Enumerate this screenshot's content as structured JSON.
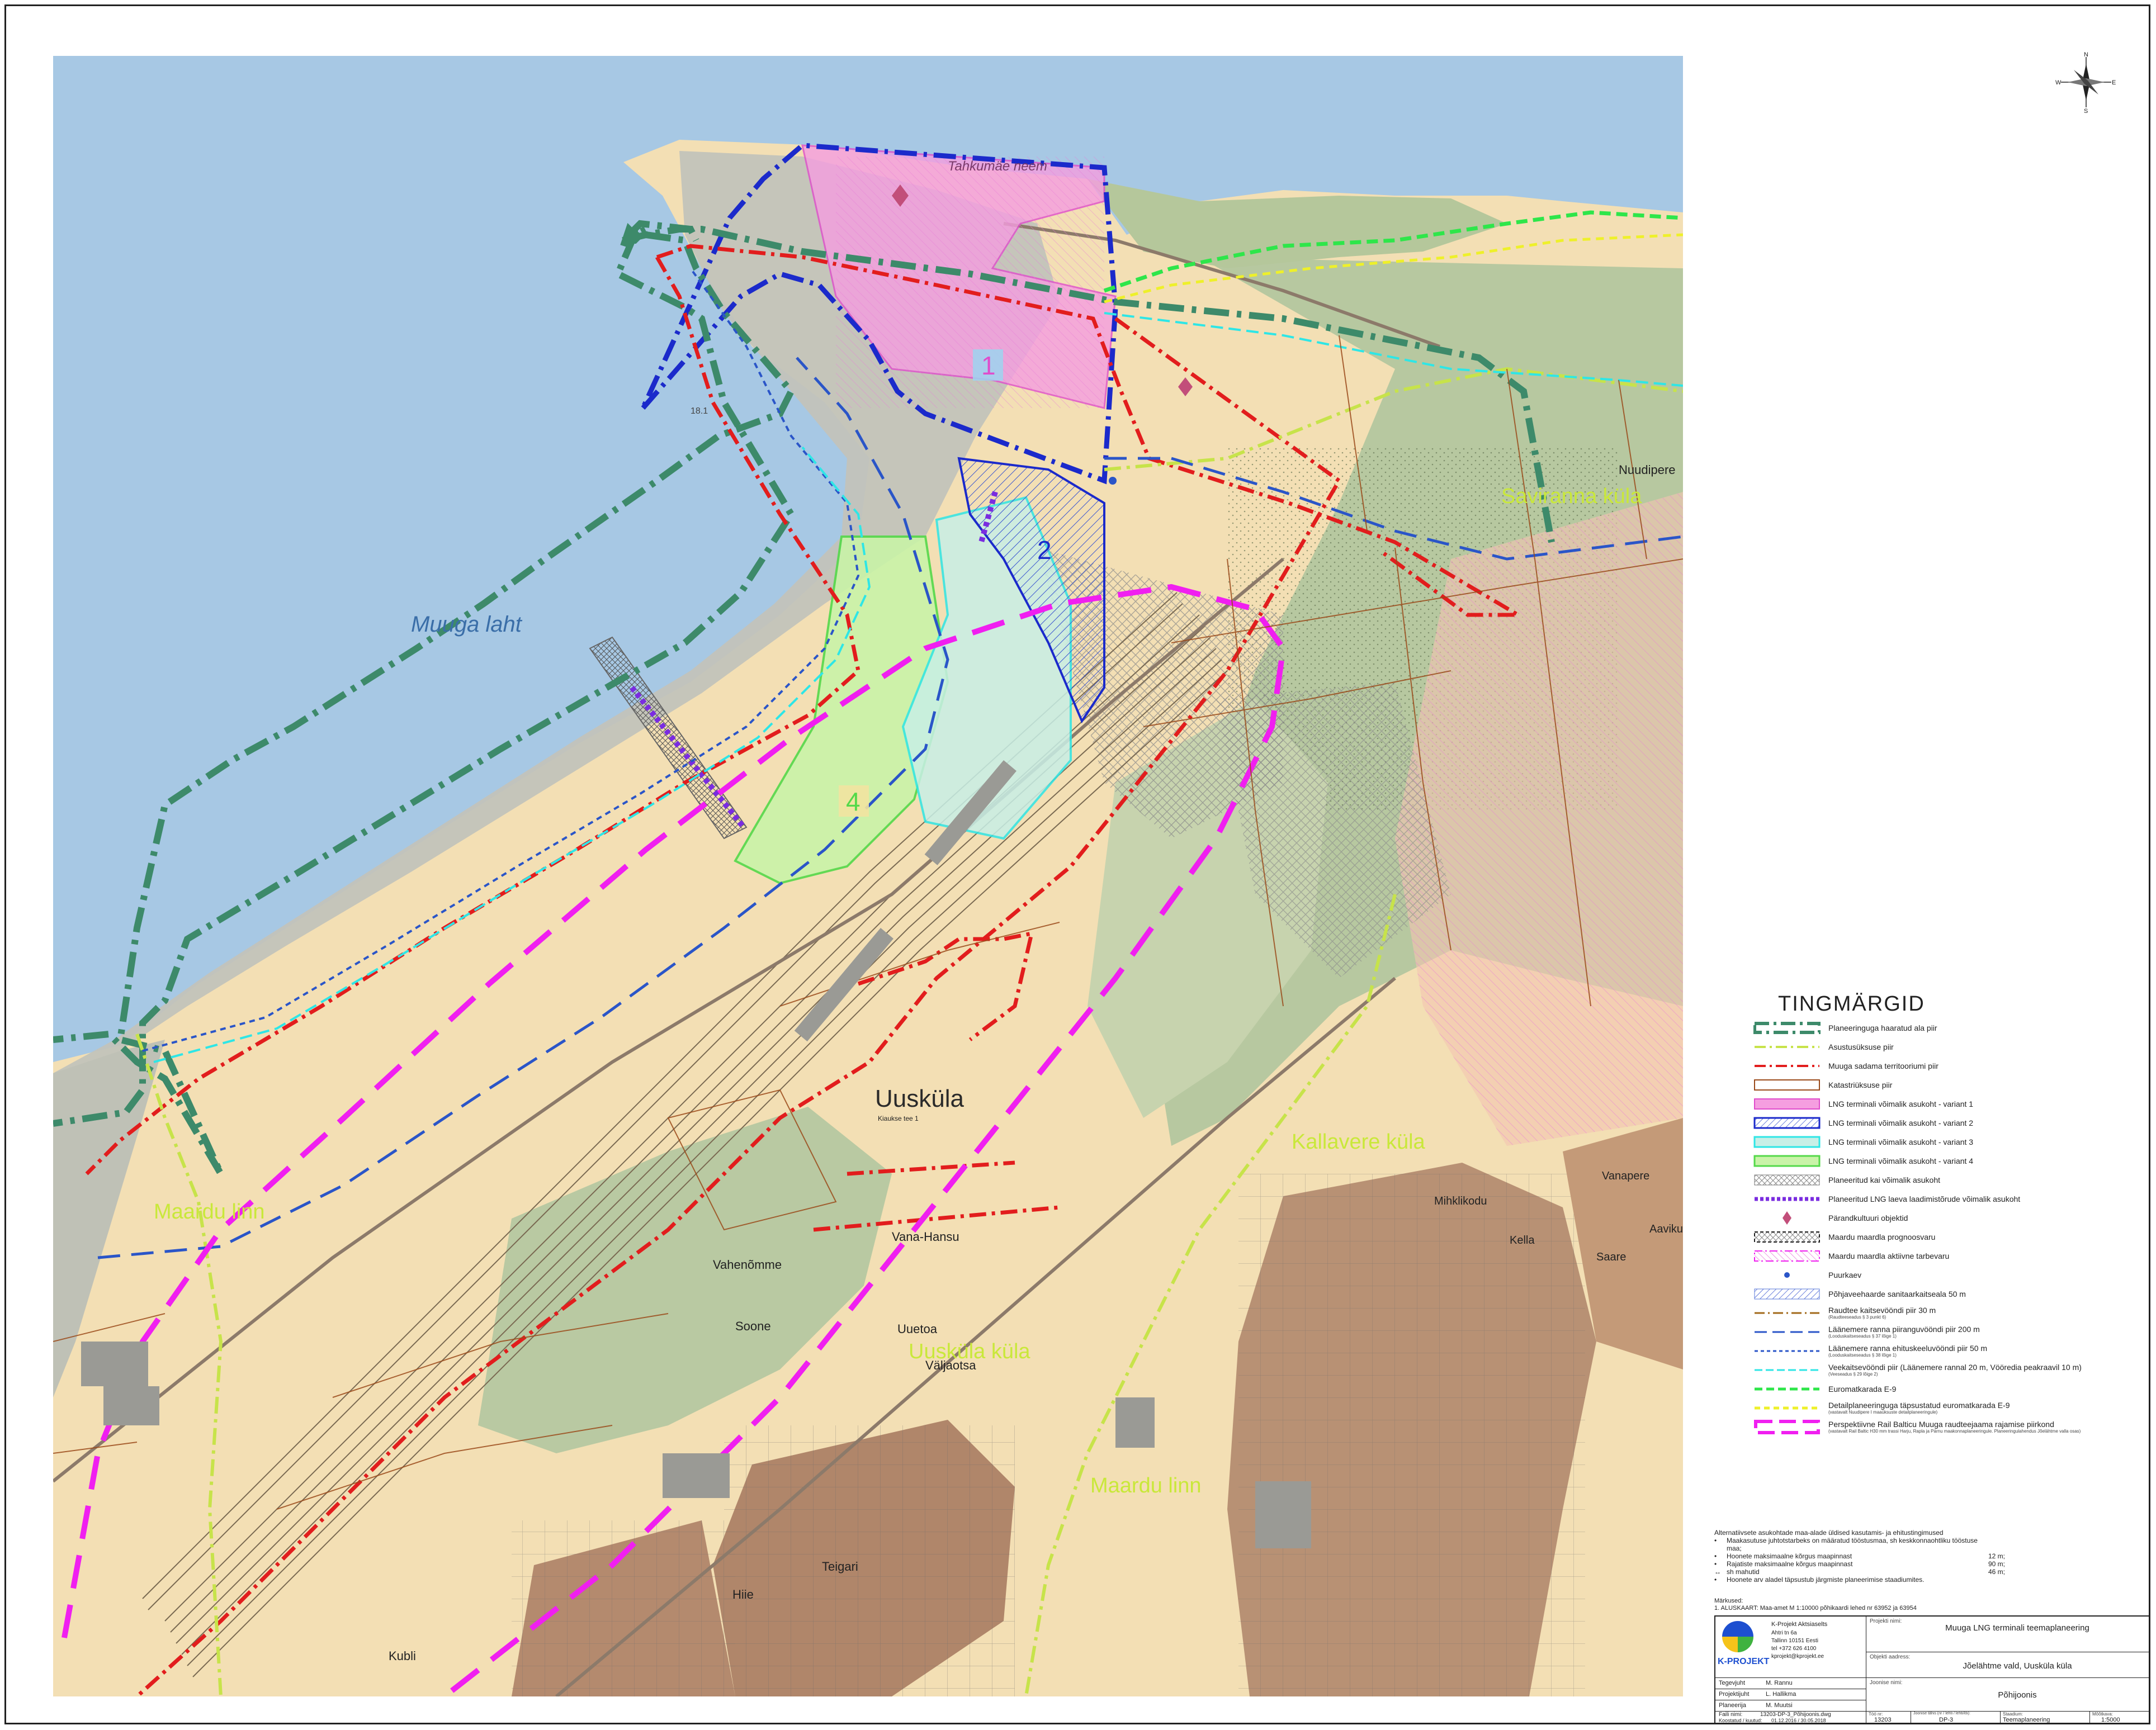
{
  "map": {
    "labels": {
      "muuga_laht": "Muuga laht",
      "tahkumae_neem": "Tahkumäe neem",
      "uuskula": "Uusküla",
      "maardu_linn_west": "Maardu linn",
      "maardu_linn_south": "Maardu linn",
      "saviranna_kula": "Saviranna küla",
      "kallavere_kula": "Kallavere küla",
      "uuskula_kula": "Uusküla küla",
      "nuudipere": "Nuudipere",
      "vahenomme": "Vahenõmme",
      "vana_hansu": "Vana-Hansu",
      "soone": "Soone",
      "uuetoa": "Uuetoa",
      "valjaotsa": "Väljaotsa",
      "teigari": "Teigari",
      "hiie": "Hiie",
      "kubli": "Kubli",
      "mihkli_kodu": "Mihklikodu",
      "kella": "Kella",
      "vanapere": "Vanapere",
      "aavik": "Aaviku",
      "saare": "Saare",
      "variant_1": "1",
      "variant_2": "2",
      "variant_4": "4",
      "parcel_kiaukse": "Kiaukse tee 1",
      "depth_181": "18.1"
    },
    "colors": {
      "sea": "#a7c8e4",
      "land": "#f3dfb4",
      "port": "#c2c3bb",
      "forest": "#b7c8a0",
      "residential": "#b89174",
      "plan_border": "#3d8a6a",
      "settlement_border": "#c7e34a",
      "port_border": "#e21d1d",
      "cadastral": "#9a4a1a",
      "variant1": "#f59ee0",
      "variant2": "#1b2acb",
      "variant3": "#2ee6e6",
      "variant4": "#54d94a",
      "quay": "#7a2ce0",
      "pipeline": "#f01ff0",
      "coast_200": "#2a55c8",
      "eurovelo": "#2ee64a"
    }
  },
  "compass": {
    "n": "N",
    "s": "S",
    "w": "W",
    "e": "E"
  },
  "legend": {
    "title": "TINGMÄRGID",
    "items": [
      {
        "key": "plan",
        "text": "Planeeringuga haaratud ala piir",
        "sub": ""
      },
      {
        "key": "settlement",
        "text": "Asustusüksuse piir",
        "sub": ""
      },
      {
        "key": "port",
        "text": "Muuga sadama territooriumi piir",
        "sub": ""
      },
      {
        "key": "cadastral",
        "text": "Katastriüksuse piir",
        "sub": ""
      },
      {
        "key": "v1",
        "text": "LNG terminali võimalik asukoht - variant 1",
        "sub": ""
      },
      {
        "key": "v2",
        "text": "LNG terminali võimalik asukoht - variant 2",
        "sub": ""
      },
      {
        "key": "v3",
        "text": "LNG terminali võimalik asukoht - variant 3",
        "sub": ""
      },
      {
        "key": "v4",
        "text": "LNG terminali võimalik asukoht - variant 4",
        "sub": ""
      },
      {
        "key": "quay_area",
        "text": "Planeeritud kai võimalik asukoht",
        "sub": ""
      },
      {
        "key": "quay_line",
        "text": "Planeeritud LNG laeva laadimistõrude võimalik asukoht",
        "sub": ""
      },
      {
        "key": "heritage",
        "text": "Pärandkultuuri objektid",
        "sub": ""
      },
      {
        "key": "deposit_prog",
        "text": "Maardu maardla prognoosvaru",
        "sub": ""
      },
      {
        "key": "deposit_active",
        "text": "Maardu maardla aktiivne tarbevaru",
        "sub": ""
      },
      {
        "key": "well",
        "text": "Puurkaev",
        "sub": ""
      },
      {
        "key": "groundwater",
        "text": "Põhjaveehaarde sanitaarkaitseala 50 m",
        "sub": ""
      },
      {
        "key": "rail",
        "text": "Raudtee kaitsevööndi piir 30 m",
        "sub": "(Raudteeseadus § 3 punkt 6)"
      },
      {
        "key": "coast200",
        "text": "Läänemere ranna piiranguvööndi piir 200 m",
        "sub": "(Looduskaitseseadus § 37 lõige 1)"
      },
      {
        "key": "coast50",
        "text": "Läänemere ranna ehituskeeluvööndi piir 50 m",
        "sub": "(Looduskaitseseadus § 38 lõige 1)"
      },
      {
        "key": "water",
        "text": "Veekaitsevööndi piir (Läänemere rannal 20 m, Vööredia peakraavil 10 m)",
        "sub": "(Veeseadus § 29 lõige 2)"
      },
      {
        "key": "eurovelo",
        "text": "Euromatkarada E-9",
        "sub": ""
      },
      {
        "key": "eurovelo_plan",
        "text": "Detailplaneeringuga täpsustatud euromatkarada E-9",
        "sub": "(vastavalt Nuudipere I maaüksuste detailplaneeringule)"
      },
      {
        "key": "railbaltica",
        "text": "Perspektiivne Rail Balticu Muuga raudteejaama rajamise piirkond",
        "sub": "(vastavalt Rail Baltic H30 mm trassi Harju, Rapla ja Pärnu maakonnaplaneeringule. Planeeringulahendus Jõelähtme valla osas)"
      }
    ]
  },
  "notes": {
    "heading": "Alternatiivsete asukohtade maa-alade üldised kasutamis- ja ehitustingimused",
    "rows": [
      {
        "bullet": "•",
        "text": "Maakasutuse juhtotstarbeks on määratud tööstusmaa, sh keskkonnaohtliku tööstuse maa;",
        "value": ""
      },
      {
        "bullet": "•",
        "text": "Hoonete maksimaalne kõrgus maapinnast",
        "value": "12 m;"
      },
      {
        "bullet": "•",
        "text": "Rajatiste maksimaalne kõrgus maapinnast",
        "value": "90 m;"
      },
      {
        "bullet": "↔",
        "text": "sh mahutid",
        "value": "46 m;"
      },
      {
        "bullet": "•",
        "text": "Hoonete arv aladel täpsustub järgmiste planeerimise staadiumites.",
        "value": ""
      }
    ],
    "remarks_title": "Märkused:",
    "remarks": "1.    ALUSKAART: Maa-amet M 1:10000 põhikaardi lehed nr 63952 ja 63954"
  },
  "titleblock": {
    "company_logo": "K-PROJEKT",
    "company_name": "K-Projekt Aktsiaselts",
    "company_addr1": "Ahtri tn 6a",
    "company_addr2": "Tallinn 10151 Eesti",
    "company_tel": "tel +372 626 4100",
    "company_mail": "kprojekt@kprojekt.ee",
    "project_label": "Projekti nimi:",
    "project_name": "Muuga LNG terminali teemaplaneering",
    "object_label": "Objekti aadress:",
    "object_address": "Jõelähtme vald, Uusküla küla",
    "drawing_label": "Joonise nimi:",
    "drawing_name": "Põhijoonis",
    "r1_label": "Tegevjuht",
    "r1_name": "M. Rannu",
    "r2_label": "Projektijuht",
    "r2_name": "L. Hallikma",
    "r3_label": "Planeerija",
    "r3_name": "M. Muutsi",
    "file_label": "Faili nimi:",
    "file_name": "13203-DP-3_Põhijoonis.dwg",
    "date_label": "Koostatud / kuutud:",
    "date_value": "01.12.2016  /  30.05.2018",
    "job_label": "Töö nr:",
    "job_value": "13203",
    "sheet_label": "Joonise tähis (nr / lehti / lehti/lõi):",
    "sheet_value": "DP-3",
    "stage_label": "Staadium:",
    "stage_value": "Teemaplaneering",
    "scale_label": "Mõõtkava:",
    "scale_value": "1:5000"
  }
}
